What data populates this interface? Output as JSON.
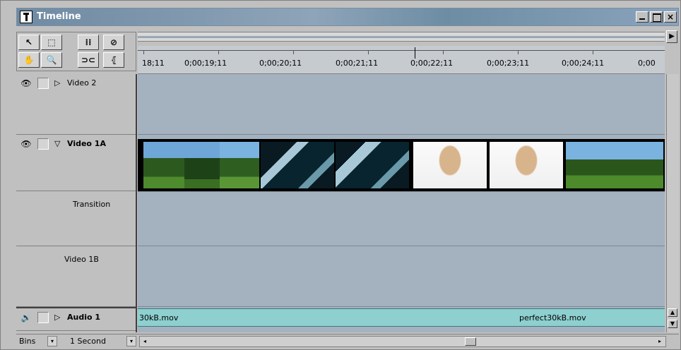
{
  "window": {
    "title": "Timeline"
  },
  "titlebar_buttons": {
    "minimize": "minimize",
    "maximize": "maximize",
    "close": "×"
  },
  "tools": {
    "row1": [
      "↖",
      "⬚",
      "⁞⁞",
      "⊘"
    ],
    "row2": [
      "✋",
      "🔍",
      "⊃⊂",
      "⦃"
    ]
  },
  "ruler": {
    "labels": [
      "18;11",
      "0;00;19;11",
      "0;00;20;11",
      "0;00;21;11",
      "0;00;22;11",
      "0;00;23;11",
      "0;00;24;11",
      "0;00"
    ]
  },
  "tracks": {
    "video2": {
      "name": "Video 2",
      "expander": "▷"
    },
    "video1a": {
      "name": "Video 1A",
      "expander": "▽"
    },
    "transition": {
      "name": "Transition"
    },
    "video1b": {
      "name": "Video 1B"
    },
    "audio1": {
      "name": "Audio 1",
      "expander": "▷"
    }
  },
  "icons": {
    "eye": "👁",
    "speaker": "🔊"
  },
  "audio_clip": {
    "left_label": "30kB.mov",
    "right_label": "perfect30kB.mov"
  },
  "bottom": {
    "bins_label": "Bins",
    "zoom_label": "1 Second",
    "dropdown_glyph": "▾",
    "scroll_left": "◂",
    "scroll_right": "▸"
  },
  "colors": {
    "track_bg": "#a4b2c0",
    "audio_clip": "#8ecfcf",
    "title_bar": "#7a93aa"
  }
}
